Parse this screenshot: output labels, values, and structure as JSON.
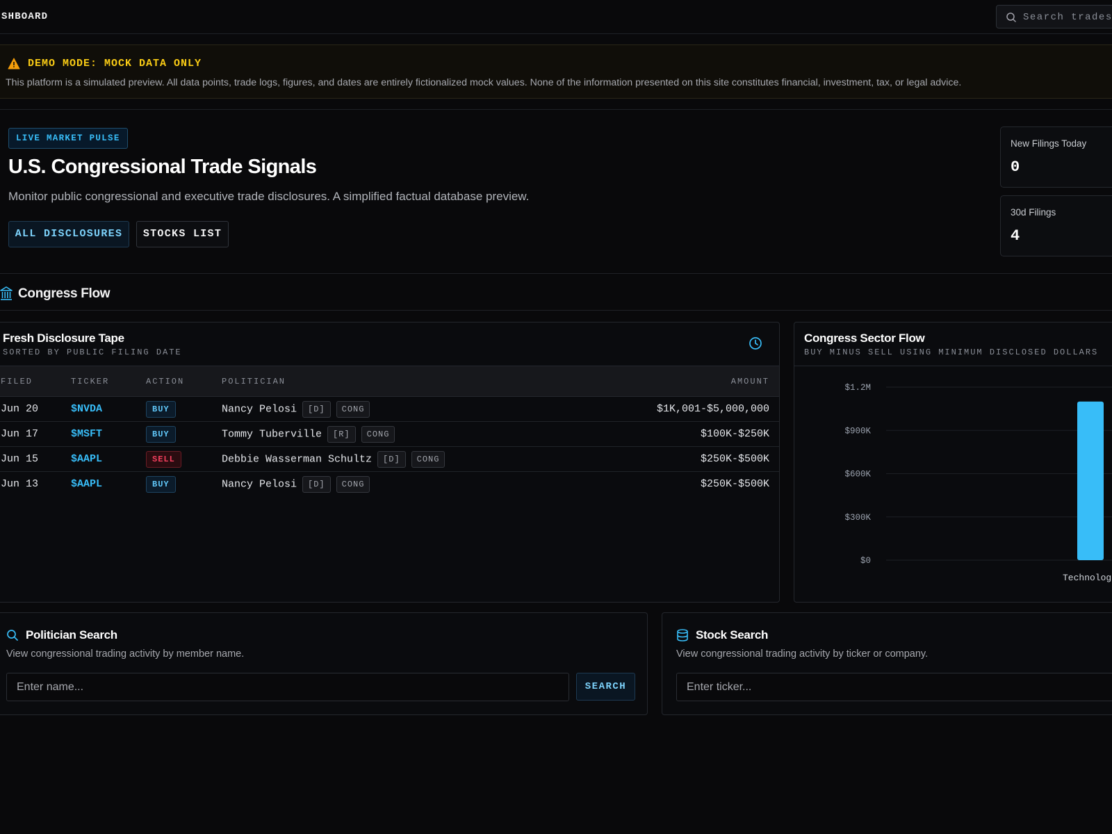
{
  "header": {
    "brand": "SHBOARD",
    "search_placeholder": "Search trades"
  },
  "demo_banner": {
    "title": "DEMO MODE: MOCK DATA ONLY",
    "text": "This platform is a simulated preview. All data points, trade logs, figures, and dates are entirely fictionalized mock values. None of the information presented on this site constitutes financial, investment, tax, or legal advice."
  },
  "hero": {
    "badge": "LIVE MARKET PULSE",
    "title": "U.S. Congressional Trade Signals",
    "subtitle": "Monitor public congressional and executive trade disclosures. A simplified factual database preview.",
    "btn_all": "ALL DISCLOSURES",
    "btn_stocks": "STOCKS LIST"
  },
  "stats": [
    {
      "label": "New Filings Today",
      "value": "0"
    },
    {
      "label": "30d Filings",
      "value": "4"
    }
  ],
  "section": {
    "title": "Congress Flow"
  },
  "tape": {
    "title": "Fresh Disclosure Tape",
    "subtitle": "SORTED BY PUBLIC FILING DATE",
    "columns": {
      "filed": "FILED",
      "ticker": "TICKER",
      "action": "ACTION",
      "politician": "POLITICIAN",
      "amount": "AMOUNT"
    },
    "rows": [
      {
        "filed": "Jun 20",
        "ticker": "$NVDA",
        "action": "BUY",
        "politician": "Nancy Pelosi",
        "party": "[D]",
        "chamber": "CONG",
        "amount": "$1K,001-$5,000,000"
      },
      {
        "filed": "Jun 17",
        "ticker": "$MSFT",
        "action": "BUY",
        "politician": "Tommy Tuberville",
        "party": "[R]",
        "chamber": "CONG",
        "amount": "$100K-$250K"
      },
      {
        "filed": "Jun 15",
        "ticker": "$AAPL",
        "action": "SELL",
        "politician": "Debbie Wasserman Schultz",
        "party": "[D]",
        "chamber": "CONG",
        "amount": "$250K-$500K"
      },
      {
        "filed": "Jun 13",
        "ticker": "$AAPL",
        "action": "BUY",
        "politician": "Nancy Pelosi",
        "party": "[D]",
        "chamber": "CONG",
        "amount": "$250K-$500K"
      }
    ]
  },
  "sector": {
    "title": "Congress Sector Flow",
    "subtitle": "BUY MINUS SELL USING MINIMUM DISCLOSED DOLLARS"
  },
  "chart_data": {
    "type": "bar",
    "categories": [
      "Technolog"
    ],
    "values": [
      1100000
    ],
    "ylim": [
      0,
      1200000
    ],
    "yticks": [
      0,
      300000,
      600000,
      900000,
      1200000
    ],
    "ytick_labels": [
      "$0",
      "$300K",
      "$600K",
      "$900K",
      "$1.2M"
    ],
    "grid": true,
    "color": "#38bdf8"
  },
  "politician_search": {
    "title": "Politician Search",
    "subtitle": "View congressional trading activity by member name.",
    "placeholder": "Enter name...",
    "button": "SEARCH"
  },
  "stock_search": {
    "title": "Stock Search",
    "subtitle": "View congressional trading activity by ticker or company.",
    "placeholder": "Enter ticker..."
  },
  "colors": {
    "accent": "#38bdf8",
    "sell": "#f43f5e",
    "warning": "#facc15"
  }
}
